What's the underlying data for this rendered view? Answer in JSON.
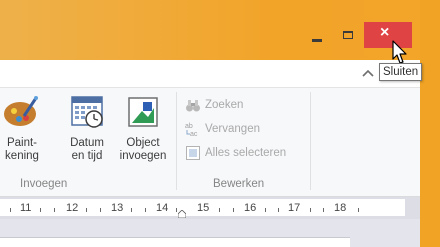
{
  "window": {
    "accent_color": "#f3a52a",
    "close_color": "#e04343",
    "controls": {
      "minimize_icon": "minimize-icon",
      "maximize_icon": "maximize-icon",
      "close_label": "×",
      "close_tooltip": "Sluiten"
    }
  },
  "ribbon": {
    "insert_group": {
      "label": "Invoegen",
      "buttons": [
        {
          "line1": "Paint-",
          "line2": "kening",
          "icon": "paint-icon"
        },
        {
          "line1": "Datum",
          "line2": "en tijd",
          "icon": "calendar-clock-icon"
        },
        {
          "line1": "Object",
          "line2": "invoegen",
          "icon": "insert-object-icon"
        }
      ]
    },
    "edit_group": {
      "label": "Bewerken",
      "buttons": [
        {
          "label": "Zoeken",
          "icon": "binoculars-icon"
        },
        {
          "label": "Vervangen",
          "icon": "replace-icon"
        },
        {
          "label": "Alles selecteren",
          "icon": "select-all-icon"
        }
      ]
    }
  },
  "ruler": {
    "ticks": [
      "11",
      "12",
      "13",
      "14",
      "15",
      "16",
      "17",
      "18"
    ]
  }
}
